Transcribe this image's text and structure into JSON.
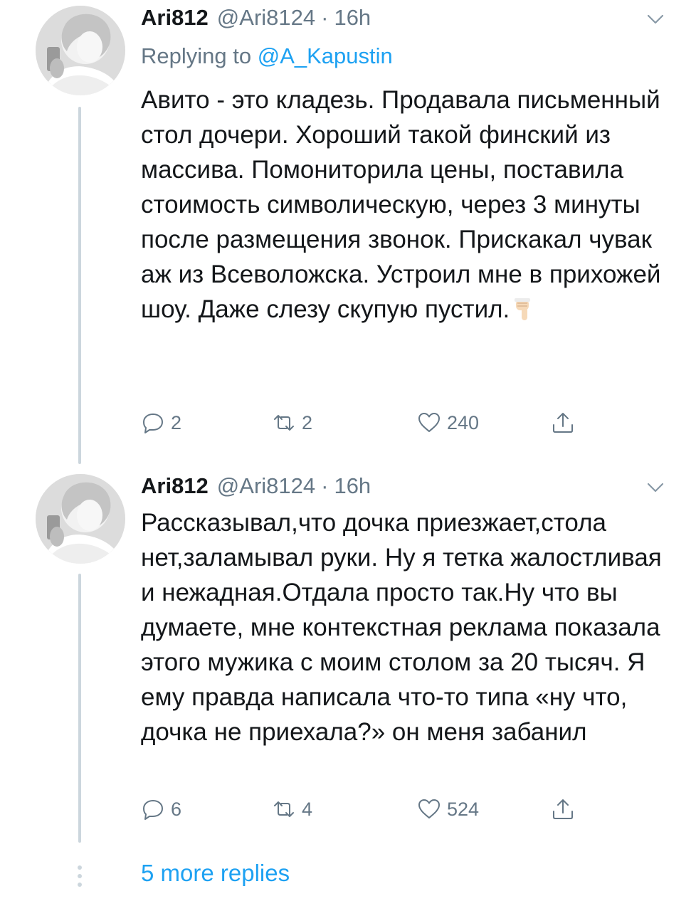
{
  "tweets": [
    {
      "name": "Ari812",
      "handle": "@Ari8124",
      "separator": "·",
      "time": "16h",
      "replying_prefix": "Replying to ",
      "replying_to": "@A_Kapustin",
      "text": "Авито - это кладезь. Продавала письменный стол дочери. Хороший такой финский из массива. Помониторила цены, поставила стоимость символическую, через 3 минуты после размещения звонок. Прискакал чувак аж из Всеволожска. Устроил мне в прихожей шоу. Даже слезу скупую пустил.",
      "emoji": "pointing-down-hand",
      "replies": "2",
      "retweets": "2",
      "likes": "240"
    },
    {
      "name": "Ari812",
      "handle": "@Ari8124",
      "separator": "·",
      "time": "16h",
      "text": "Рассказывал,что дочка приезжает,стола нет,заламывал руки. Ну я тетка жалостливая и нежадная.Отдала просто так.Ну что вы думаете, мне контекстная реклама показала этого мужика с моим столом за 20 тысяч. Я ему правда написала что-то типа «ну что, дочка не приехала?» он меня забанил",
      "replies": "6",
      "retweets": "4",
      "likes": "524"
    }
  ],
  "more_replies": "5 more replies",
  "colors": {
    "text": "#14171a",
    "secondary": "#657786",
    "link": "#1da1f2",
    "thread_line": "#ccd6dd"
  }
}
